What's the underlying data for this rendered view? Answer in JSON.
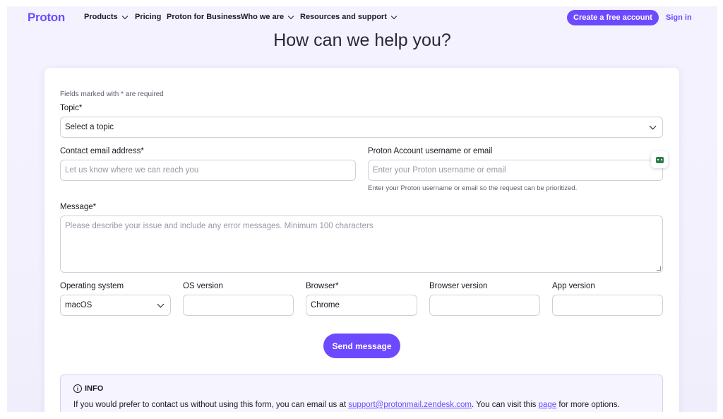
{
  "nav": {
    "logo": "Proton",
    "items": [
      {
        "label": "Products",
        "dropdown": true
      },
      {
        "label": "Pricing",
        "dropdown": false
      },
      {
        "label": "Proton for Business",
        "dropdown": false
      },
      {
        "label": "Who we are",
        "dropdown": true
      },
      {
        "label": "Resources and support",
        "dropdown": true
      }
    ],
    "create_account": "Create a free account",
    "sign_in": "Sign in"
  },
  "page": {
    "title": "How can we help you?"
  },
  "form": {
    "required_note": "Fields marked with * are required",
    "topic": {
      "label": "Topic*",
      "value": "Select a topic"
    },
    "email": {
      "label": "Contact email address*",
      "placeholder": "Let us know where we can reach you"
    },
    "username": {
      "label": "Proton Account username or email",
      "placeholder": "Enter your Proton username or email",
      "hint": "Enter your Proton username or email so the request can be prioritized."
    },
    "message": {
      "label": "Message*",
      "placeholder": "Please describe your issue and include any error messages. Minimum 100 characters"
    },
    "os": {
      "label": "Operating system",
      "value": "macOS"
    },
    "os_version": {
      "label": "OS version",
      "value": ""
    },
    "browser": {
      "label": "Browser*",
      "value": "Chrome"
    },
    "browser_version": {
      "label": "Browser version",
      "value": ""
    },
    "app_version": {
      "label": "App version",
      "value": ""
    },
    "send": "Send message"
  },
  "info": {
    "heading": "INFO",
    "text_before": "If you would prefer to contact us without using this form, you can email us at ",
    "email_link": "support@protonmail.zendesk.com",
    "text_middle": ". You can visit this ",
    "page_link": "page",
    "text_after": " for more options."
  },
  "colors": {
    "accent": "#6d4aff",
    "background": "#f4f2fe"
  }
}
